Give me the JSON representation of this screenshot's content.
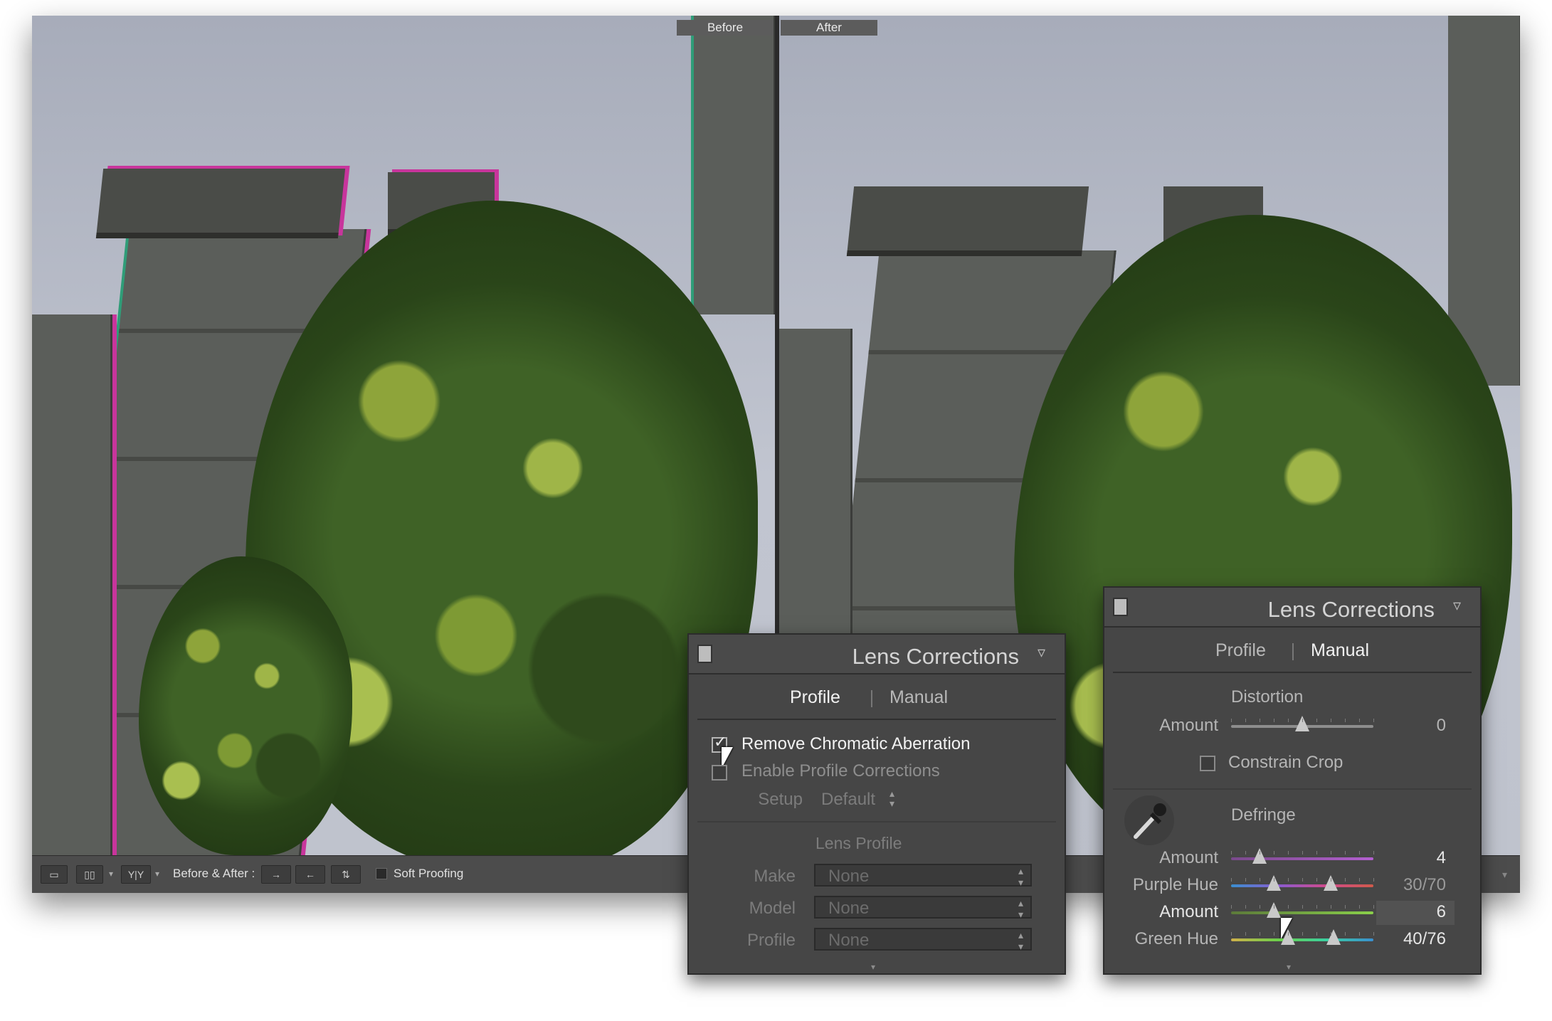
{
  "preview": {
    "before_label": "Before",
    "after_label": "After"
  },
  "toolbar": {
    "view_loupe_icon": "loupe-view-icon",
    "view_compare_icon": "compare-view-icon",
    "yy_label": "Y|Y",
    "before_after_label": "Before & After :",
    "soft_proofing_label": "Soft Proofing"
  },
  "panel_profile": {
    "title": "Lens Corrections",
    "tabs": [
      {
        "label": "Profile",
        "active": true
      },
      {
        "label": "Manual",
        "active": false
      }
    ],
    "remove_ca_label": "Remove Chromatic Aberration",
    "remove_ca_checked": true,
    "enable_profile_label": "Enable Profile Corrections",
    "enable_profile_checked": false,
    "setup_label": "Setup",
    "setup_value": "Default",
    "lens_profile_header": "Lens Profile",
    "make_label": "Make",
    "make_value": "None",
    "model_label": "Model",
    "model_value": "None",
    "profile_label": "Profile",
    "profile_value": "None"
  },
  "panel_manual": {
    "title": "Lens Corrections",
    "tabs": [
      {
        "label": "Profile",
        "active": false
      },
      {
        "label": "Manual",
        "active": true
      }
    ],
    "distortion_header": "Distortion",
    "distortion_amount_label": "Amount",
    "distortion_amount_value": "0",
    "distortion_fraction": 0.5,
    "constrain_crop_label": "Constrain Crop",
    "constrain_crop_checked": false,
    "defringe_header": "Defringe",
    "eyedropper_icon": "eyedropper-icon",
    "purple_amount_label": "Amount",
    "purple_amount_value": "4",
    "purple_amount_fraction": 0.2,
    "purple_hue_label": "Purple Hue",
    "purple_hue_value": "30/70",
    "purple_hue_low": 0.3,
    "purple_hue_high": 0.7,
    "green_amount_label": "Amount",
    "green_amount_value": "6",
    "green_amount_fraction": 0.3,
    "green_hue_label": "Green Hue",
    "green_hue_value": "40/76",
    "green_hue_low": 0.4,
    "green_hue_high": 0.72
  },
  "colors": {
    "purple_fringe": "#c8359c",
    "green_fringe": "#2f9d78",
    "panel_bg": "#464646",
    "active_text": "#f2f2f2"
  }
}
